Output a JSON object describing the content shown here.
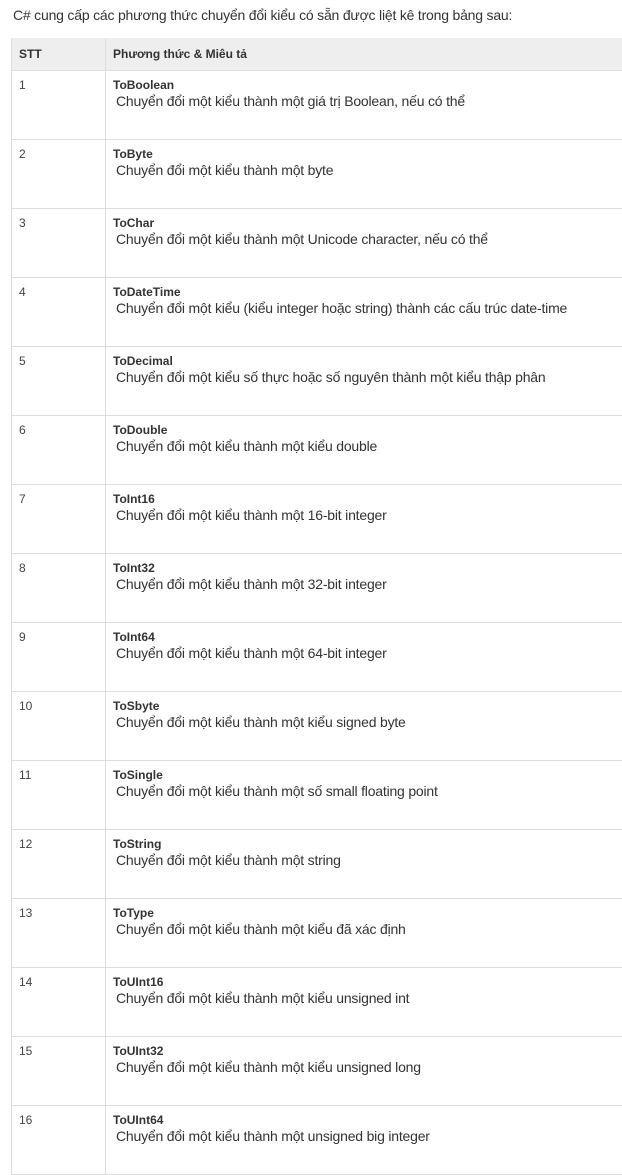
{
  "intro": "C# cung cấp các phương thức chuyển đổi kiểu có sẵn được liệt kê trong bảng sau:",
  "table": {
    "headers": [
      "STT",
      "Phương thức & Miêu tả"
    ],
    "rows": [
      {
        "num": "1",
        "name": "ToBoolean",
        "desc": "Chuyển đổi một kiểu thành một giá trị Boolean, nếu có thể"
      },
      {
        "num": "2",
        "name": "ToByte",
        "desc": "Chuyển đổi một kiểu thành một byte"
      },
      {
        "num": "3",
        "name": "ToChar",
        "desc": "Chuyển đổi một kiểu thành một Unicode character, nếu có thể"
      },
      {
        "num": "4",
        "name": "ToDateTime",
        "desc": "Chuyển đổi một kiểu (kiểu integer hoặc string) thành các cấu trúc date-time"
      },
      {
        "num": "5",
        "name": "ToDecimal",
        "desc": "Chuyển đổi một kiểu số thực hoặc số nguyên thành một kiểu thập phân"
      },
      {
        "num": "6",
        "name": "ToDouble",
        "desc": "Chuyển đổi một kiểu thành một kiểu double"
      },
      {
        "num": "7",
        "name": "ToInt16",
        "desc": "Chuyển đổi một kiểu thành một 16-bit integer"
      },
      {
        "num": "8",
        "name": "ToInt32",
        "desc": "Chuyển đổi một kiểu thành một 32-bit integer"
      },
      {
        "num": "9",
        "name": "ToInt64",
        "desc": "Chuyển đổi một kiểu thành một 64-bit integer"
      },
      {
        "num": "10",
        "name": "ToSbyte",
        "desc": "Chuyển đổi một kiểu thành một kiểu signed byte"
      },
      {
        "num": "11",
        "name": "ToSingle",
        "desc": "Chuyển đổi một kiểu thành một số small floating point"
      },
      {
        "num": "12",
        "name": "ToString",
        "desc": "Chuyển đổi một kiểu thành một string"
      },
      {
        "num": "13",
        "name": "ToType",
        "desc": "Chuyển đổi một kiểu thành một kiểu đã xác định"
      },
      {
        "num": "14",
        "name": "ToUInt16",
        "desc": "Chuyển đổi một kiểu thành một kiểu unsigned int"
      },
      {
        "num": "15",
        "name": "ToUInt32",
        "desc": "Chuyển đổi một kiểu thành một kiểu unsigned long"
      },
      {
        "num": "16",
        "name": "ToUInt64",
        "desc": "Chuyển đổi một kiểu thành một unsigned big integer"
      }
    ]
  }
}
